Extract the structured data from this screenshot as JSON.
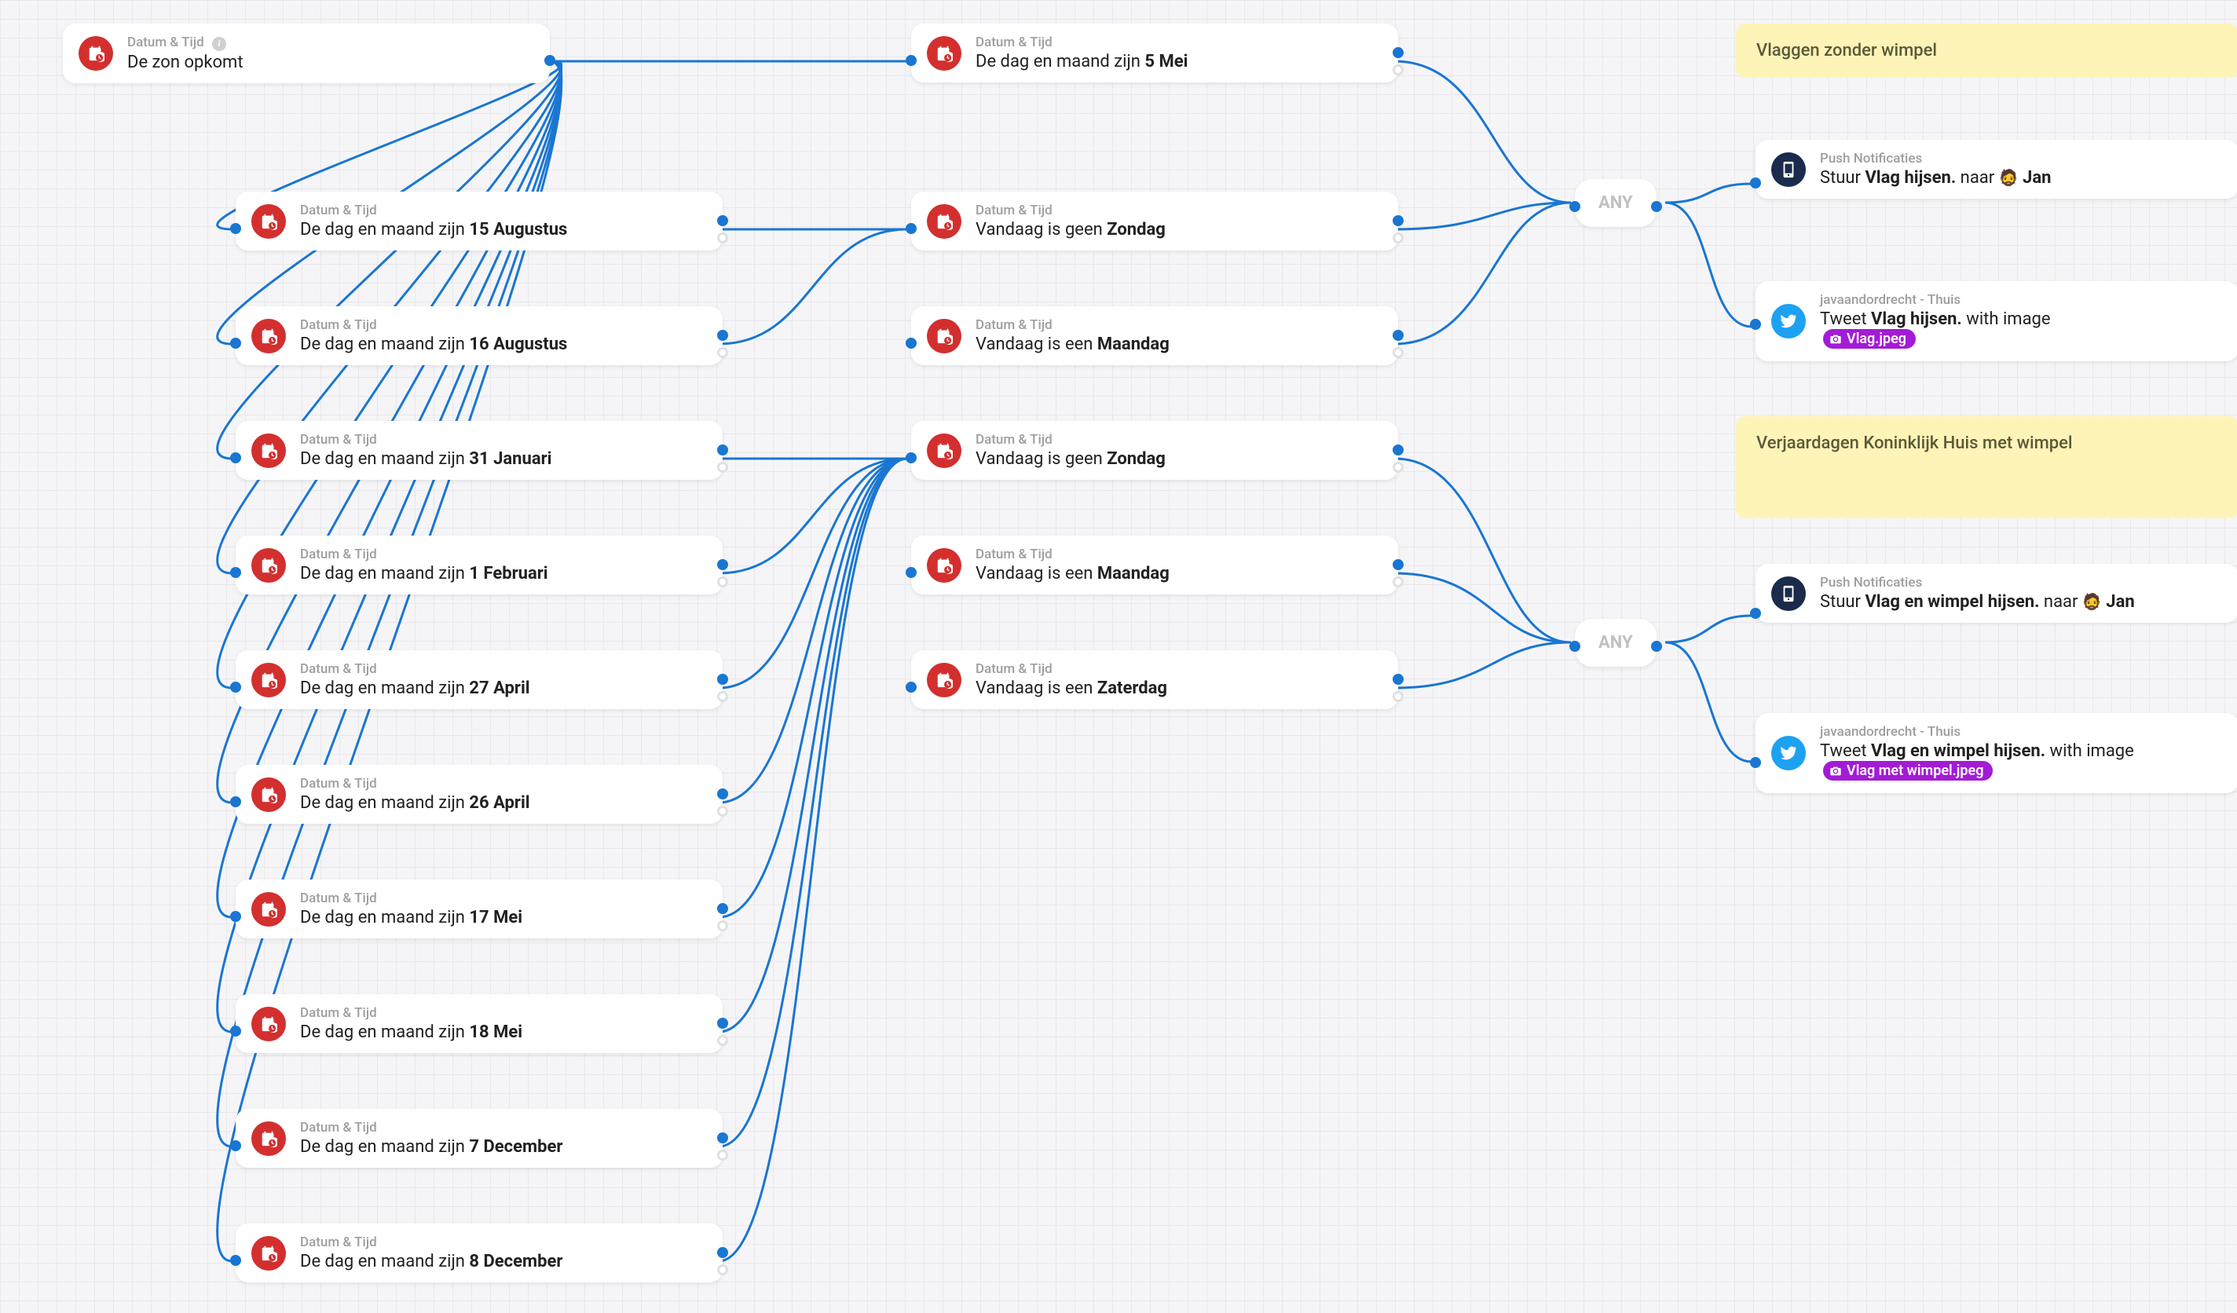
{
  "labels": {
    "datetime": "Datum & Tijd",
    "push": "Push Notificaties",
    "twitter_src": "javaandordrecht - Thuis",
    "any": "ANY"
  },
  "trigger": {
    "title": "De zon opkomt"
  },
  "dates": [
    {
      "prefix": "De dag en maand zijn ",
      "bold": "15 Augustus"
    },
    {
      "prefix": "De dag en maand zijn ",
      "bold": "16 Augustus"
    },
    {
      "prefix": "De dag en maand zijn ",
      "bold": "31 Januari"
    },
    {
      "prefix": "De dag en maand zijn ",
      "bold": "1 Februari"
    },
    {
      "prefix": "De dag en maand zijn ",
      "bold": "27 April"
    },
    {
      "prefix": "De dag en maand zijn ",
      "bold": "26 April"
    },
    {
      "prefix": "De dag en maand zijn ",
      "bold": "17 Mei"
    },
    {
      "prefix": "De dag en maand zijn ",
      "bold": "18 Mei"
    },
    {
      "prefix": "De dag en maand zijn ",
      "bold": "7 December"
    },
    {
      "prefix": "De dag en maand zijn ",
      "bold": "8 December"
    }
  ],
  "col2top": {
    "prefix": "De dag en maand zijn ",
    "bold": "5 Mei"
  },
  "col2a": [
    {
      "prefix": "Vandaag is geen ",
      "bold": "Zondag"
    },
    {
      "prefix": "Vandaag is een ",
      "bold": "Maandag"
    }
  ],
  "col2b": [
    {
      "prefix": "Vandaag is geen ",
      "bold": "Zondag"
    },
    {
      "prefix": "Vandaag is een ",
      "bold": "Maandag"
    },
    {
      "prefix": "Vandaag is een ",
      "bold": "Zaterdag"
    }
  ],
  "notes": [
    "Vlaggen zonder wimpel",
    "Verjaardagen Koninklijk Huis met wimpel"
  ],
  "actions1": {
    "push_pre": "Stuur ",
    "push_bold": "Vlag hijsen.",
    "push_mid": " naar ",
    "push_emoji": "🧔",
    "push_name": "Jan",
    "tw_pre": "Tweet ",
    "tw_bold": "Vlag hijsen.",
    "tw_post": " with image ",
    "tw_attach": "Vlag.jpeg"
  },
  "actions2": {
    "push_pre": "Stuur ",
    "push_bold": "Vlag en wimpel hijsen.",
    "push_mid": " naar ",
    "push_emoji": "🧔",
    "push_name": "Jan",
    "tw_pre": "Tweet ",
    "tw_bold": "Vlag en wimpel hijsen.",
    "tw_post": " with image ",
    "tw_attach": "Vlag met wimpel.jpeg"
  }
}
